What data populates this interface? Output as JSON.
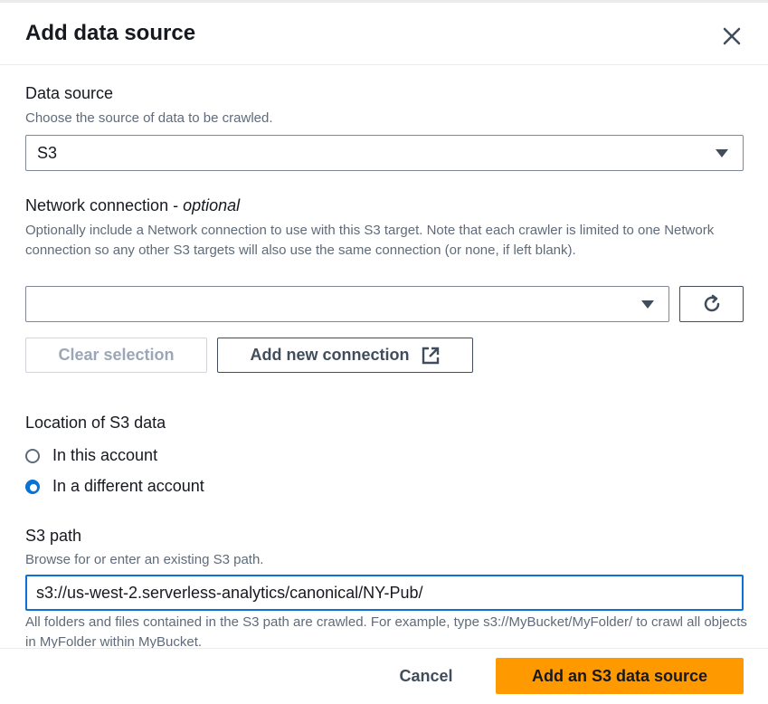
{
  "dialog": {
    "title": "Add data source",
    "close_icon": "close-icon"
  },
  "data_source": {
    "label": "Data source",
    "description": "Choose the source of data to be crawled.",
    "selected": "S3"
  },
  "network_connection": {
    "label": "Network connection - ",
    "label_suffix": "optional",
    "description": "Optionally include a Network connection to use with this S3 target. Note that each crawler is limited to one Network connection so any other S3 targets will also use the same connection (or none, if left blank).",
    "selected": "",
    "refresh_icon": "refresh-icon",
    "clear_label": "Clear selection",
    "add_label": "Add new connection",
    "external_icon": "external-link-icon"
  },
  "location": {
    "label": "Location of S3 data",
    "options": [
      {
        "label": "In this account",
        "checked": false
      },
      {
        "label": "In a different account",
        "checked": true
      }
    ]
  },
  "s3_path": {
    "label": "S3 path",
    "description": "Browse for or enter an existing S3 path.",
    "value": "s3://us-west-2.serverless-analytics/canonical/NY-Pub/",
    "hint": "All folders and files contained in the S3 path are crawled. For example, type s3://MyBucket/MyFolder/ to crawl all objects in MyFolder within MyBucket."
  },
  "footer": {
    "cancel_label": "Cancel",
    "primary_label": "Add an S3 data source"
  },
  "colors": {
    "primary": "#ff9900",
    "focus": "#0972d3",
    "text": "#16191f",
    "muted": "#5f6b7a"
  }
}
